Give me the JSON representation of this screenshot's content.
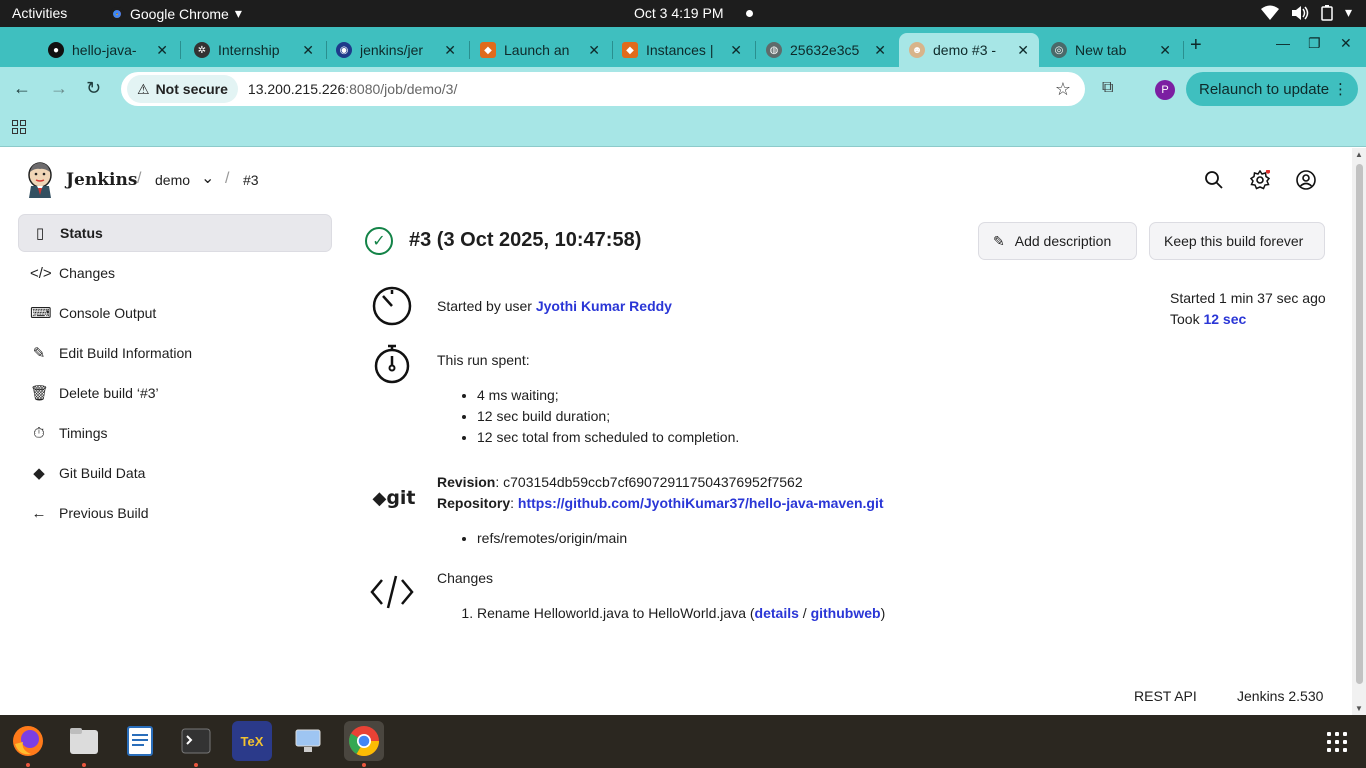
{
  "system_bar": {
    "activities": "Activities",
    "app_name": "Google Chrome",
    "clock": "Oct 3  4:19 PM"
  },
  "tabs": [
    {
      "label": "hello-java-",
      "icon": "github-icon"
    },
    {
      "label": "Internship",
      "icon": "openai-icon"
    },
    {
      "label": "jenkins/jer",
      "icon": "web-icon"
    },
    {
      "label": "Launch an",
      "icon": "aws-icon"
    },
    {
      "label": "Instances |",
      "icon": "aws-icon"
    },
    {
      "label": "25632e3c5",
      "icon": "globe-icon"
    },
    {
      "label": "demo #3 -",
      "icon": "jenkins-icon",
      "active": true
    },
    {
      "label": "New tab",
      "icon": "chrome-icon"
    }
  ],
  "toolbar": {
    "not_secure": "Not secure",
    "url_host": "13.200.215.226",
    "url_rest": ":8080/job/demo/3/",
    "relaunch": "Relaunch to update",
    "profile_initial": "P"
  },
  "header": {
    "app_name": "Jenkins",
    "breadcrumb_job": "demo",
    "breadcrumb_build": "#3"
  },
  "sidebar": {
    "items": [
      {
        "label": "Status",
        "icon": "document-icon"
      },
      {
        "label": "Changes",
        "icon": "code-icon"
      },
      {
        "label": "Console Output",
        "icon": "terminal-icon"
      },
      {
        "label": "Edit Build Information",
        "icon": "edit-icon"
      },
      {
        "label": "Delete build ‘#3’",
        "icon": "trash-icon"
      },
      {
        "label": "Timings",
        "icon": "stopwatch-icon"
      },
      {
        "label": "Git Build Data",
        "icon": "git-icon"
      },
      {
        "label": "Previous Build",
        "icon": "arrow-left-icon"
      }
    ]
  },
  "build": {
    "title": "#3 (3 Oct 2025, 10:47:58)",
    "add_description": "Add description",
    "keep_forever": "Keep this build forever",
    "started_by_prefix": "Started by user ",
    "started_by_user": "Jyothi Kumar Reddy",
    "started_ago": "Started 1 min 37 sec ago",
    "took_prefix": "Took ",
    "took": "12 sec",
    "run_spent": "This run spent:",
    "run_items": [
      "4 ms waiting;",
      "12 sec build duration;",
      "12 sec total from scheduled to completion."
    ],
    "revision_label": "Revision",
    "revision": ": c703154db59ccb7cf690729117504376952f7562",
    "repository_label": "Repository",
    "repository_sep": ": ",
    "repository_url": "https://github.com/JyothiKumar37/hello-java-maven.git",
    "refs": [
      "refs/remotes/origin/main"
    ],
    "changes_label": "Changes",
    "change_text": "Rename Helloworld.java to HelloWorld.java (",
    "change_details": "details",
    "change_sep": " / ",
    "change_githubweb": "githubweb",
    "change_close": ")",
    "git_logo_text": "git"
  },
  "footer": {
    "rest_api": "REST API",
    "version": "Jenkins 2.530"
  },
  "dock": {
    "tex_label": "TeX"
  }
}
